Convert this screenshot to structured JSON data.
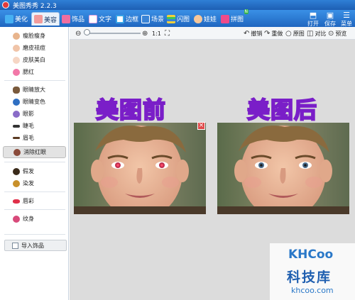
{
  "window": {
    "title": "美图秀秀 2.2.3"
  },
  "tabs": [
    {
      "label": "美化",
      "icon": "beautify-icon",
      "active": false
    },
    {
      "label": "美容",
      "icon": "makeup-icon",
      "active": true
    },
    {
      "label": "饰品",
      "icon": "accessory-icon",
      "active": false
    },
    {
      "label": "文字",
      "icon": "text-icon",
      "active": false
    },
    {
      "label": "边框",
      "icon": "frame-icon",
      "active": false
    },
    {
      "label": "场景",
      "icon": "scene-icon",
      "active": false
    },
    {
      "label": "闪图",
      "icon": "flash-icon",
      "active": false
    },
    {
      "label": "娃娃",
      "icon": "doll-icon",
      "active": false
    },
    {
      "label": "拼图",
      "icon": "puzzle-icon",
      "active": false,
      "badge": "N"
    }
  ],
  "top_actions": {
    "open": "打开",
    "save": "保存",
    "menu": "菜单"
  },
  "left_panel": {
    "items": [
      {
        "label": "瘦脸瘦身",
        "icon": "slim-face-icon"
      },
      {
        "label": "磨皮祛痘",
        "icon": "smooth-skin-icon"
      },
      {
        "label": "皮肤美白",
        "icon": "skin-whiten-icon"
      },
      {
        "label": "腮红",
        "icon": "blush-icon"
      },
      {
        "label": "眼睛放大",
        "icon": "eye-enlarge-icon"
      },
      {
        "label": "眼睛变色",
        "icon": "eye-color-icon"
      },
      {
        "label": "眼影",
        "icon": "eyeshadow-icon"
      },
      {
        "label": "睫毛",
        "icon": "eyelash-icon"
      },
      {
        "label": "眉毛",
        "icon": "eyebrow-icon"
      },
      {
        "label": "消除红眼",
        "icon": "red-eye-icon",
        "selected": true
      },
      {
        "label": "假发",
        "icon": "wig-icon"
      },
      {
        "label": "染发",
        "icon": "hair-dye-icon"
      },
      {
        "label": "唇彩",
        "icon": "lip-icon"
      },
      {
        "label": "纹身",
        "icon": "tattoo-icon"
      }
    ],
    "import_button": "导入饰品"
  },
  "toolbar": {
    "zoom_ratio": "1:1",
    "undo": "撤销",
    "redo": "重做",
    "original": "原图",
    "compare": "对比",
    "preview": "预览"
  },
  "canvas": {
    "before_label": "美图前",
    "after_label": "美图后"
  },
  "watermark": {
    "logo": "KHCoo",
    "name": "科技库",
    "url": "khcoo.com"
  },
  "colors": {
    "title_blue": "#1d5fb3",
    "tab_blue": "#2a7ad8",
    "label_fill": "#c77de8",
    "label_stroke": "#7a1ec8",
    "canvas_bg": "#dcdcdc"
  }
}
